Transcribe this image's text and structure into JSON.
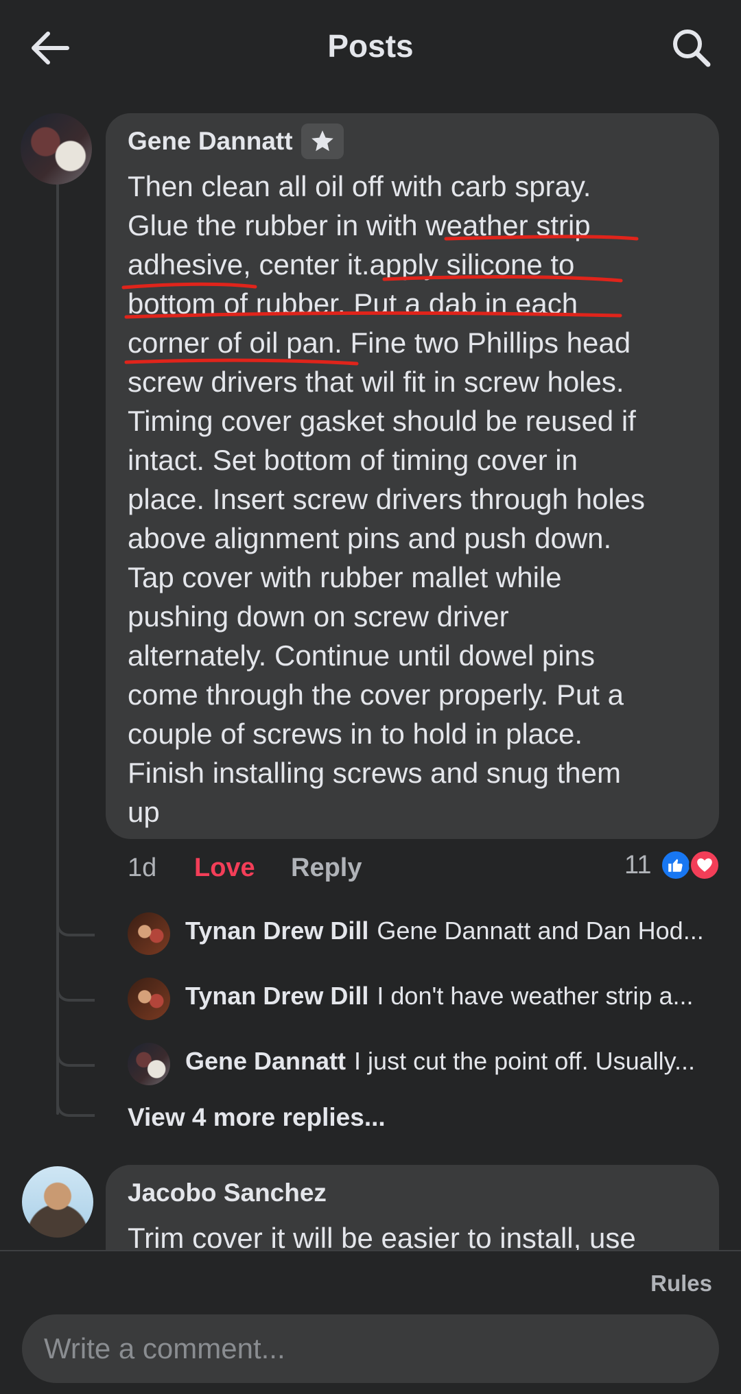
{
  "header": {
    "title": "Posts",
    "back_icon": "arrow-left-icon",
    "search_icon": "search-icon"
  },
  "main_comment": {
    "author": "Gene Dannatt",
    "badge_icon": "star-icon",
    "lines": [
      "Then clean all oil off with carb spray.",
      "Glue the rubber in with weather strip",
      "adhesive, center it.apply silicone to",
      "bottom of rubber. Put a dab in each",
      "corner of oil pan. Fine two Phillips head",
      "screw drivers that wil fit in screw holes.",
      "Timing cover gasket should be reused if",
      "intact. Set bottom of timing cover in",
      "place. Insert screw drivers through holes",
      "above alignment pins and push down.",
      "Tap cover with rubber mallet while",
      "pushing down on screw driver",
      "alternately. Continue until dowel pins",
      "come through the cover properly. Put a",
      "couple of screws in to hold in place.",
      "Finish installing screws and snug them",
      "up"
    ],
    "annotation_color": "#e0241b",
    "time": "1d",
    "love_label": "Love",
    "reply_label": "Reply",
    "reaction_count": "11",
    "reactions": [
      "like-icon",
      "heart-icon"
    ]
  },
  "replies": [
    {
      "name": "Tynan Drew Dill",
      "snippet": "Gene Dannatt and Dan Hod..."
    },
    {
      "name": "Tynan Drew Dill",
      "snippet": "I don't have weather strip a..."
    },
    {
      "name": "Gene Dannatt",
      "snippet": "I just cut the point off. Usually..."
    }
  ],
  "view_more": "View 4 more replies...",
  "next_comment": {
    "author": "Jacobo Sanchez",
    "text": "Trim cover it will be easier to install, use"
  },
  "footer": {
    "rules": "Rules",
    "comment_placeholder": "Write a comment..."
  }
}
